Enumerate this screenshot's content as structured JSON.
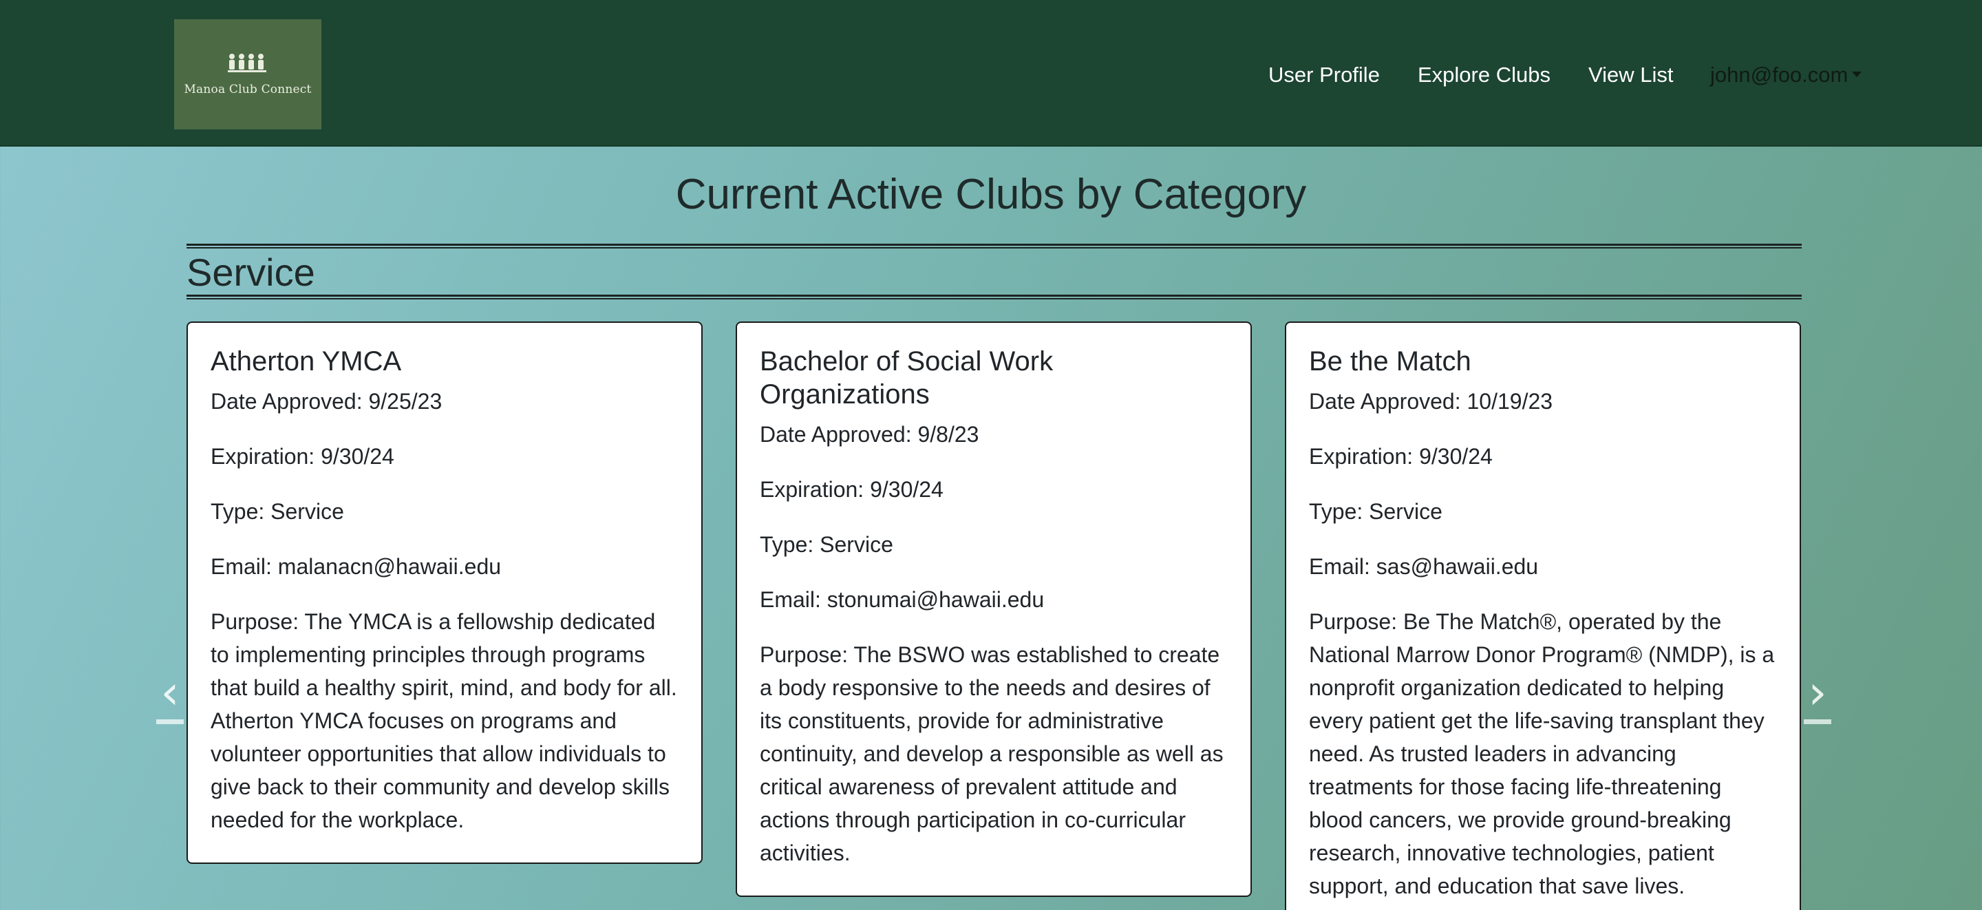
{
  "brand": {
    "logo_text": "Manoa Club Connect"
  },
  "nav": {
    "user_profile": "User Profile",
    "explore_clubs": "Explore Clubs",
    "view_list": "View List",
    "user_email": "john@foo.com"
  },
  "page": {
    "title": "Current Active Clubs by Category",
    "category": "Service"
  },
  "cards": [
    {
      "name": "Atherton YMCA",
      "approved": "Date Approved: 9/25/23",
      "expiration": "Expiration: 9/30/24",
      "type": "Type: Service",
      "email": "Email: malanacn@hawaii.edu",
      "purpose": "Purpose: The YMCA is a fellowship dedicated to implementing principles through programs that build a healthy spirit, mind, and body for all. Atherton YMCA focuses on programs and volunteer opportunities that allow individuals to give back to their community and develop skills needed for the workplace."
    },
    {
      "name": "Bachelor of Social Work Organizations",
      "approved": "Date Approved: 9/8/23",
      "expiration": "Expiration: 9/30/24",
      "type": "Type: Service",
      "email": "Email: stonumai@hawaii.edu",
      "purpose": "Purpose: The BSWO was established to create a body responsive to the needs and desires of its constituents, provide for administrative continuity, and develop a responsible as well as critical awareness of prevalent attitude and actions through participation in co-curricular activities."
    },
    {
      "name": "Be the Match",
      "approved": "Date Approved: 10/19/23",
      "expiration": "Expiration: 9/30/24",
      "type": "Type: Service",
      "email": "Email: sas@hawaii.edu",
      "purpose": "Purpose: Be The Match®, operated by the National Marrow Donor Program® (NMDP), is a nonprofit organization dedicated to helping every patient get the life-saving transplant they need. As trusted leaders in advancing treatments for those facing life-threatening blood cancers, we provide ground-breaking research, innovative technologies, patient support, and education that save lives."
    }
  ],
  "carousel": {
    "prev_glyph": "‹",
    "next_glyph": "›"
  },
  "colors": {
    "navbar": "#1c4532",
    "logo_bg": "#4c6b45",
    "card_bg": "#ffffff"
  },
  "icons": {
    "prev": "chevron-left-icon",
    "next": "chevron-right-icon",
    "dropdown": "caret-down-icon"
  }
}
